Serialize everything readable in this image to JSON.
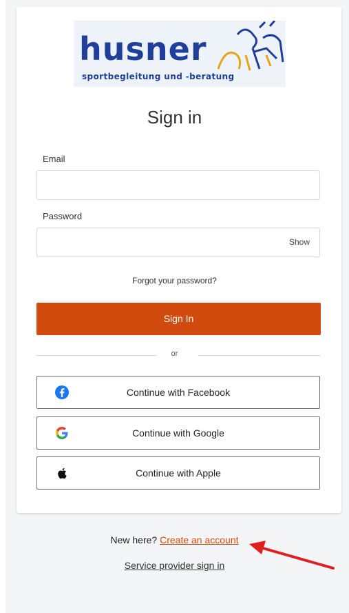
{
  "logo": {
    "word": "husner",
    "tagline": "sportbegleitung und -beratung"
  },
  "title": "Sign in",
  "email": {
    "label": "Email",
    "value": "",
    "placeholder": ""
  },
  "password": {
    "label": "Password",
    "value": "",
    "placeholder": "",
    "show_label": "Show"
  },
  "forgot_label": "Forgot your password?",
  "signin_label": "Sign In",
  "or_label": "or",
  "social": [
    {
      "label": "Continue with Facebook",
      "icon": "facebook-icon"
    },
    {
      "label": "Continue with Google",
      "icon": "google-icon"
    },
    {
      "label": "Continue with Apple",
      "icon": "apple-icon"
    }
  ],
  "footer": {
    "new_here": "New here?",
    "create_account": "Create an account",
    "service_provider": "Service provider sign in"
  },
  "colors": {
    "accent": "#d24b0e",
    "brand_blue": "#1f3f9a",
    "annotation_arrow": "#e02020"
  }
}
